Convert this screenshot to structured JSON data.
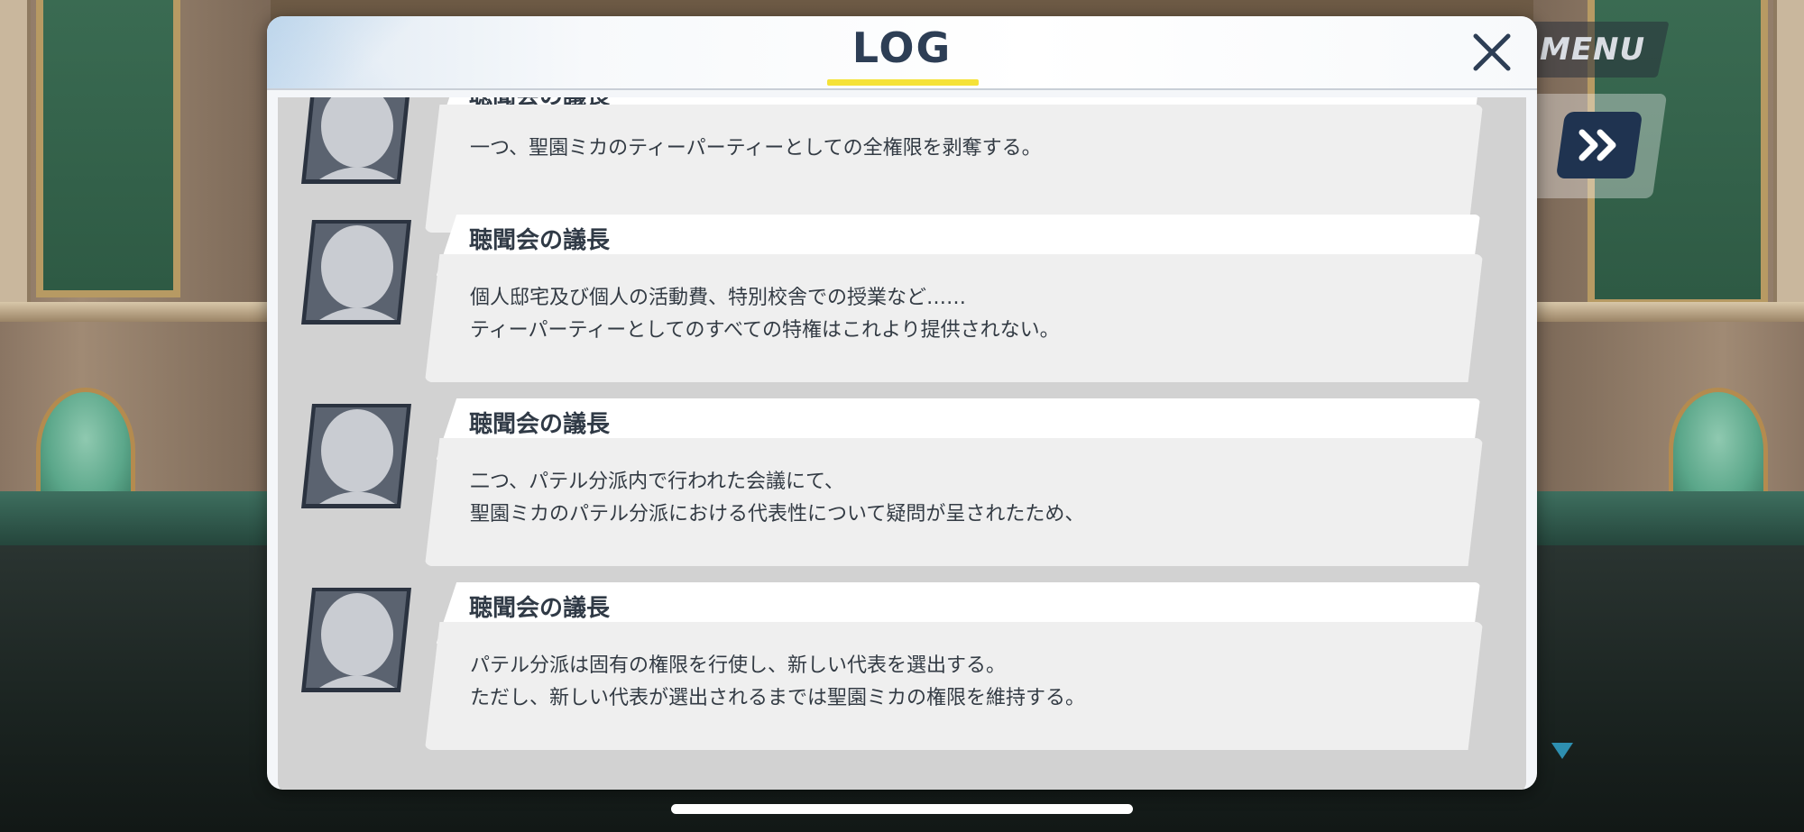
{
  "window": {
    "title": "LOG",
    "close_icon": "close-icon"
  },
  "hud": {
    "menu_label": "MENU",
    "fast_forward_icon": "fast-forward-icon",
    "next_indicator_icon": "triangle-down-icon"
  },
  "colors": {
    "title_text": "#2d3e55",
    "title_underline": "#f5e238",
    "log_body": "#d2d2d2",
    "name_plate": "#ffffff",
    "message_box": "#efefef",
    "fast_forward_button": "#1f3350"
  },
  "log": {
    "entries": [
      {
        "avatar_icon": "silhouette-avatar-icon",
        "speaker": "聴聞会の議長",
        "lines": [
          "一つ、聖園ミカのティーパーティーとしての全権限を剥奪する。",
          ""
        ]
      },
      {
        "avatar_icon": "silhouette-avatar-icon",
        "speaker": "聴聞会の議長",
        "lines": [
          "個人邸宅及び個人の活動費、特別校舎での授業など……",
          "ティーパーティーとしてのすべての特権はこれより提供されない。"
        ]
      },
      {
        "avatar_icon": "silhouette-avatar-icon",
        "speaker": "聴聞会の議長",
        "lines": [
          "二つ、パテル分派内で行われた会議にて、",
          "聖園ミカのパテル分派における代表性について疑問が呈されたため、"
        ]
      },
      {
        "avatar_icon": "silhouette-avatar-icon",
        "speaker": "聴聞会の議長",
        "lines": [
          "パテル分派は固有の権限を行使し、新しい代表を選出する。",
          "ただし、新しい代表が選出されるまでは聖園ミカの権限を維持する。"
        ]
      }
    ]
  }
}
